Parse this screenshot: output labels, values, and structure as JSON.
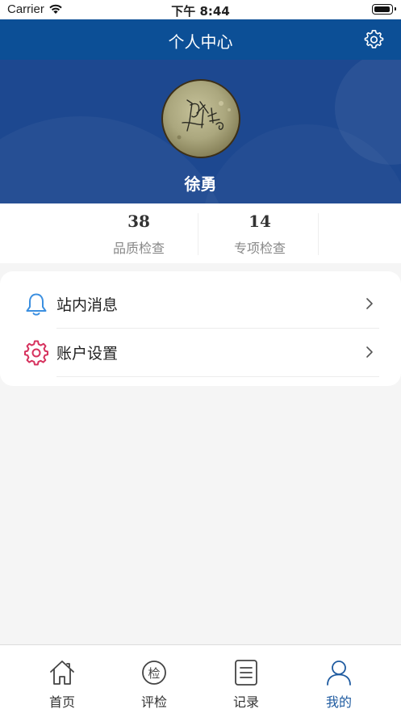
{
  "status_bar": {
    "carrier": "Carrier",
    "time": "下午 8:44"
  },
  "header": {
    "title": "个人中心"
  },
  "profile": {
    "name": "徐勇"
  },
  "stats": [
    {
      "value": "38",
      "label": "品质检查"
    },
    {
      "value": "14",
      "label": "专项检查"
    }
  ],
  "menu": [
    {
      "label": "站内消息",
      "icon": "bell-icon",
      "icon_color": "#3b8fe0"
    },
    {
      "label": "账户设置",
      "icon": "gear-icon",
      "icon_color": "#d6325e"
    }
  ],
  "tabs": [
    {
      "label": "首页",
      "icon": "home-icon",
      "active": false
    },
    {
      "label": "评检",
      "icon": "inspect-badge-icon",
      "icon_glyph": "检",
      "active": false
    },
    {
      "label": "记录",
      "icon": "records-icon",
      "active": false
    },
    {
      "label": "我的",
      "icon": "user-icon",
      "active": true
    }
  ],
  "colors": {
    "header_bg": "#0c4f96",
    "profile_bg": "#1d4890",
    "active_tab": "#1f5ba0"
  }
}
